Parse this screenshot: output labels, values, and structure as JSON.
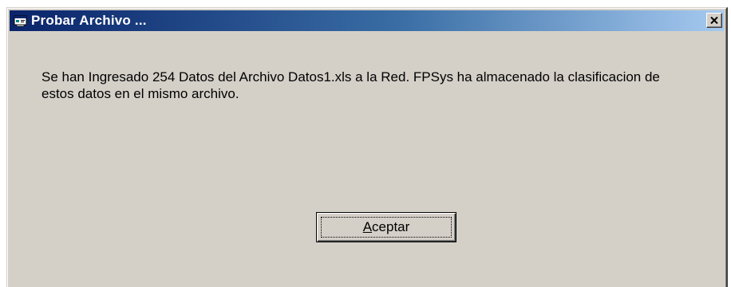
{
  "window": {
    "title": "Probar Archivo ...",
    "icon": "app-window-icon",
    "close_glyph": "✕"
  },
  "dialog": {
    "message": "Se han Ingresado 254 Datos del Archivo Datos1.xls a la Red.  FPSys ha almacenado la clasificacion de estos datos en el mismo archivo.",
    "ok_button": {
      "label": "Aceptar",
      "mnemonic": "A",
      "rest": "ceptar"
    }
  },
  "colors": {
    "titlebar_start": "#0a246a",
    "titlebar_end": "#a6caf0",
    "face": "#d4d0c8"
  }
}
